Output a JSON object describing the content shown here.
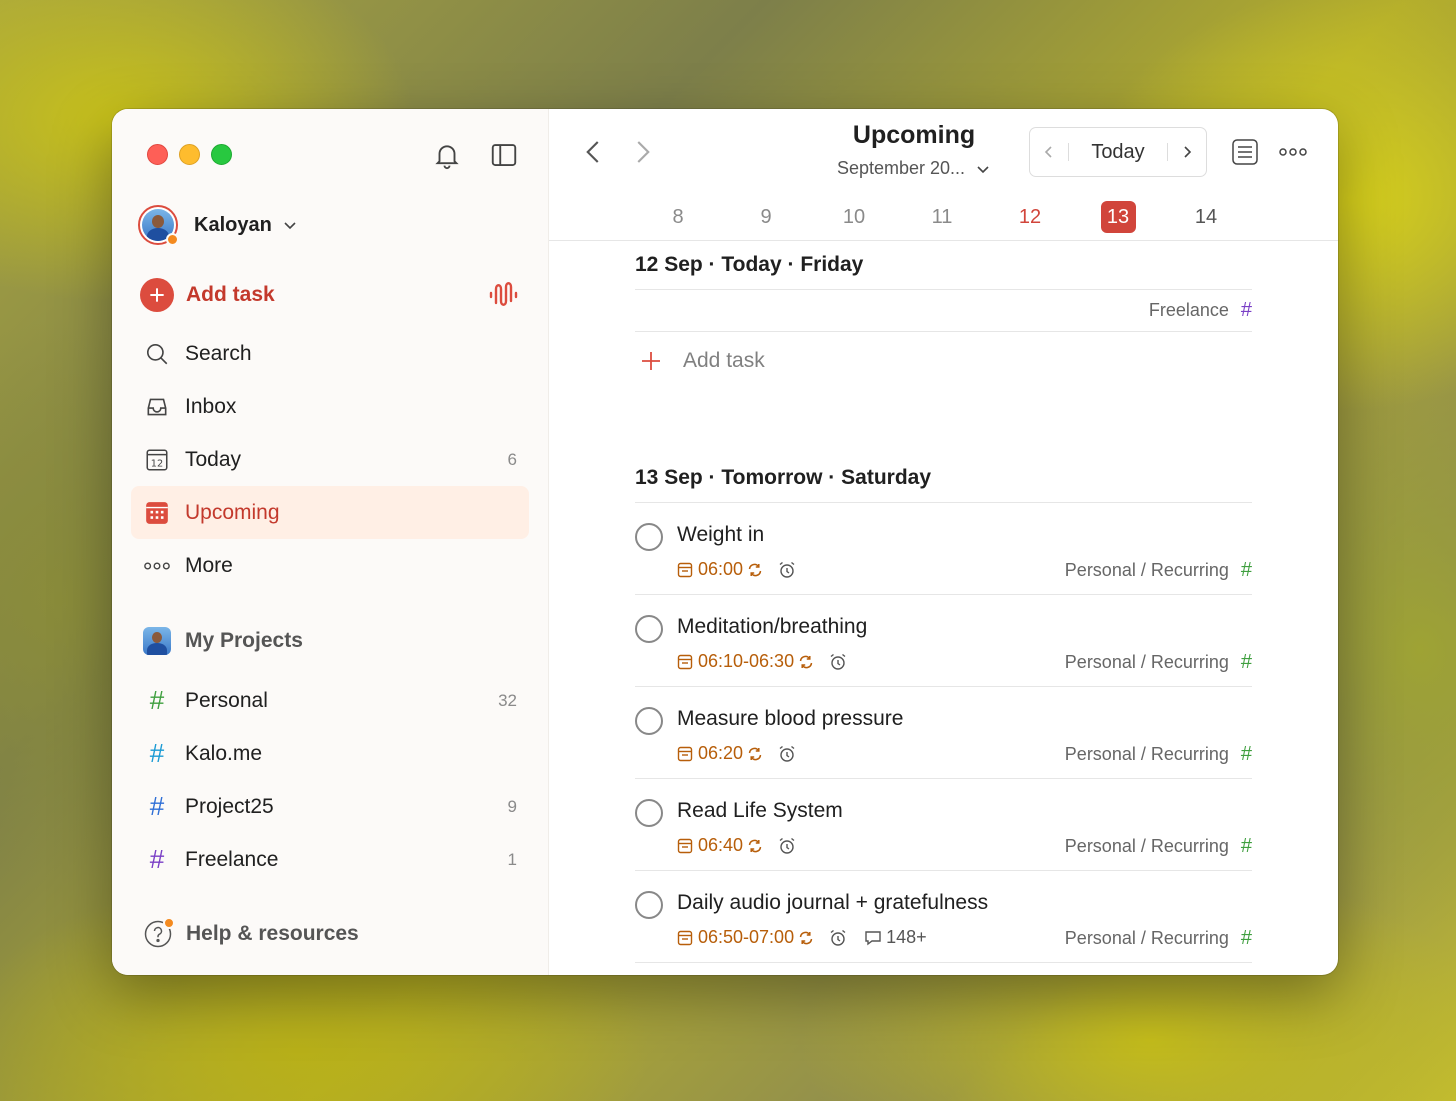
{
  "sidebar": {
    "user": {
      "name": "Kaloyan"
    },
    "add_task": "Add task",
    "nav": [
      {
        "label": "Search",
        "icon": "search-icon",
        "count": ""
      },
      {
        "label": "Inbox",
        "icon": "inbox-icon",
        "count": ""
      },
      {
        "label": "Today",
        "icon": "calendar-today-icon",
        "count": "6",
        "icon_day": "12"
      },
      {
        "label": "Upcoming",
        "icon": "calendar-upcoming-icon",
        "count": "",
        "active": true
      },
      {
        "label": "More",
        "icon": "more-dots-icon",
        "count": ""
      }
    ],
    "projects_title": "My Projects",
    "projects": [
      {
        "label": "Personal",
        "count": "32",
        "color": "#3f9f3f"
      },
      {
        "label": "Kalo.me",
        "count": "",
        "color": "#1c9bd4"
      },
      {
        "label": "Project25",
        "count": "9",
        "color": "#2f6fd6"
      },
      {
        "label": "Freelance",
        "count": "1",
        "color": "#7a3fc6"
      }
    ],
    "help": "Help & resources"
  },
  "header": {
    "title": "Upcoming",
    "month": "September 20...",
    "today_button": "Today"
  },
  "week": [
    {
      "label": "8"
    },
    {
      "label": "9"
    },
    {
      "label": "10"
    },
    {
      "label": "11"
    },
    {
      "label": "12",
      "state": "today"
    },
    {
      "label": "13",
      "state": "selected"
    },
    {
      "label": "14"
    }
  ],
  "sections": [
    {
      "title": "12 Sep · Today · Friday",
      "meta_project": "Freelance",
      "meta_project_color": "#7a3fc6",
      "add_task": "Add task"
    },
    {
      "title": "13 Sep · Tomorrow · Saturday",
      "tasks": [
        {
          "title": "Weight in",
          "time": "06:00",
          "comments": "",
          "project": "Personal / Recurring"
        },
        {
          "title": "Meditation/breathing",
          "time": "06:10-06:30",
          "comments": "",
          "project": "Personal / Recurring"
        },
        {
          "title": "Measure blood pressure",
          "time": "06:20",
          "comments": "",
          "project": "Personal / Recurring"
        },
        {
          "title": "Read Life System",
          "time": "06:40",
          "comments": "",
          "project": "Personal / Recurring"
        },
        {
          "title": "Daily audio journal + gratefulness",
          "time": "06:50-07:00",
          "comments": "148+",
          "project": "Personal / Recurring"
        }
      ]
    }
  ],
  "colors": {
    "accent": "#dc4c3e",
    "active_bg": "#ffefe5",
    "time": "#b75e0a"
  }
}
